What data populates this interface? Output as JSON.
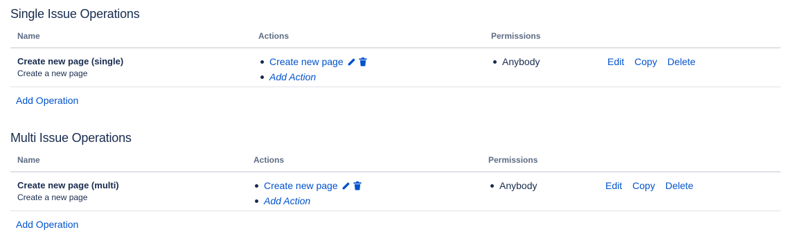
{
  "headers": {
    "name": "Name",
    "actions": "Actions",
    "permissions": "Permissions"
  },
  "sections": [
    {
      "title": "Single Issue Operations",
      "row": {
        "name": "Create new page (single)",
        "description": "Create a new page",
        "action_link": "Create new page",
        "add_action": "Add Action",
        "permission": "Anybody",
        "edit": "Edit",
        "copy": "Copy",
        "delete": "Delete"
      },
      "add_operation": "Add Operation"
    },
    {
      "title": "Multi Issue Operations",
      "row": {
        "name": "Create new page (multi)",
        "description": "Create a new page",
        "action_link": "Create new page",
        "add_action": "Add Action",
        "permission": "Anybody",
        "edit": "Edit",
        "copy": "Copy",
        "delete": "Delete"
      },
      "add_operation": "Add Operation"
    }
  ],
  "icons": {
    "edit": "pencil-icon",
    "delete": "trash-icon"
  },
  "colors": {
    "link": "#0052cc",
    "text": "#172b4d",
    "header": "#5e6c84",
    "border": "#dfe1e6"
  }
}
